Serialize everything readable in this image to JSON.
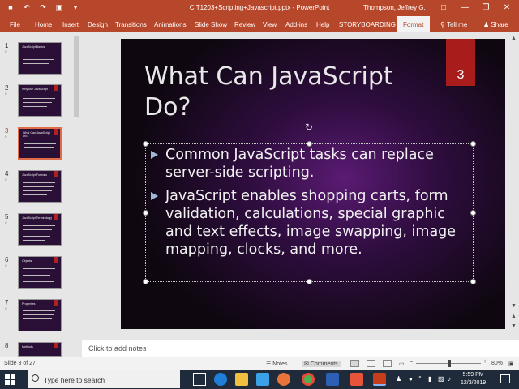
{
  "window": {
    "title": "CIT1203+Scripting+Javascript.pptx  -  PowerPoint",
    "user": "Thompson, Jeffrey G.",
    "qat_icons": [
      "save-icon",
      "undo-icon",
      "redo-icon",
      "slideshow-icon",
      "more-icon"
    ],
    "controls": [
      "minimize",
      "maximize",
      "close"
    ]
  },
  "ribbon": {
    "tabs": [
      "File",
      "Home",
      "Insert",
      "Design",
      "Transitions",
      "Animations",
      "Slide Show",
      "Review",
      "View",
      "Add-ins",
      "Help",
      "STORYBOARDING"
    ],
    "active_tab": "Format",
    "tell_me": "Tell me",
    "share": "Share"
  },
  "thumbnails": {
    "numbers": [
      "1",
      "2",
      "3",
      "4",
      "5",
      "6",
      "7",
      "8"
    ],
    "star": "*",
    "selected": "3",
    "titles": [
      "JavaScript Basics",
      "Why use JavaScript",
      "What Can JavaScript Do?",
      "JavaScript Formats",
      "JavaScript Terminology",
      "Objects",
      "Properties",
      "Methods"
    ]
  },
  "slide": {
    "title": "What Can JavaScript Do?",
    "number": "3",
    "bullets": [
      "Common JavaScript tasks can replace server-side scripting.",
      "JavaScript enables shopping carts, form validation, calculations, special graphic and text effects, image swapping, image mapping, clocks, and more."
    ]
  },
  "notes": {
    "placeholder": "Click to add notes"
  },
  "status": {
    "slide_counter": "Slide 3 of 27",
    "notes_label": "Notes",
    "comments_label": "Comments",
    "zoom": "80%"
  },
  "taskbar": {
    "search_placeholder": "Type here to search",
    "time": "5:59 PM",
    "date": "12/3/2019"
  },
  "colors": {
    "accent": "#b7472a",
    "slide_number_bg": "#a81c1c",
    "bullet_arrow": "#9fb8d8"
  }
}
